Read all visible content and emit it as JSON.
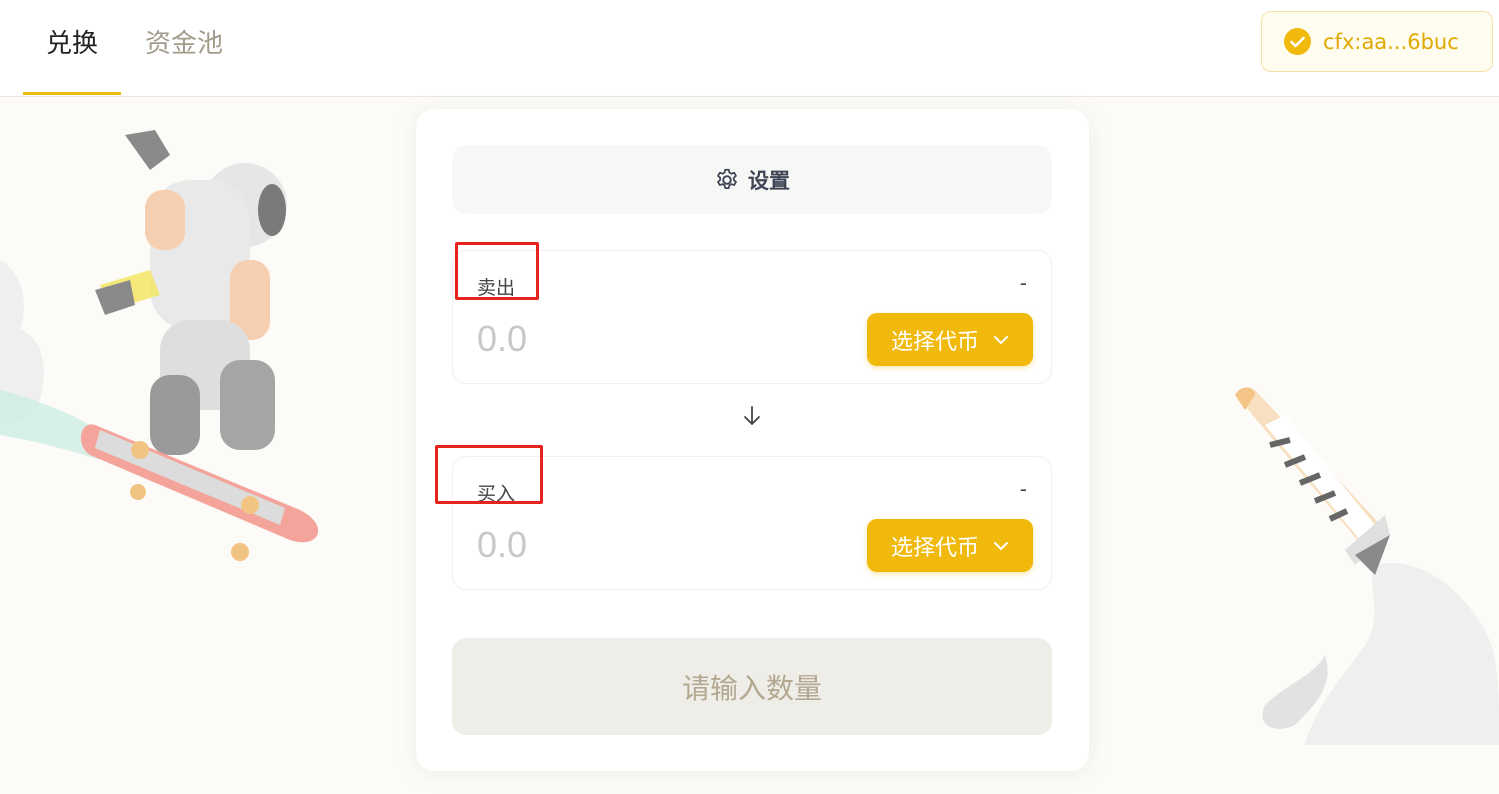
{
  "header": {
    "tabs": [
      {
        "label": "兑换",
        "active": true
      },
      {
        "label": "资金池",
        "active": false
      }
    ],
    "wallet": {
      "address": "cfx:aa...6buc",
      "icon": "check-circle-icon"
    }
  },
  "card": {
    "settings_label": "设置",
    "sell": {
      "label": "卖出",
      "balance": "-",
      "placeholder": "0.0",
      "token_button": "选择代币"
    },
    "buy": {
      "label": "买入",
      "balance": "-",
      "placeholder": "0.0",
      "token_button": "选择代币"
    },
    "submit_label": "请输入数量"
  },
  "colors": {
    "accent": "#f0b90b",
    "highlight_box": "#e8221c"
  }
}
